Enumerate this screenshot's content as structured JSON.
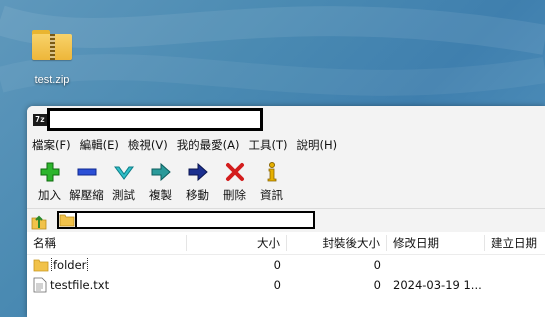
{
  "desktop": {
    "icon_label": "test.zip",
    "icon": "zip-folder-icon"
  },
  "window": {
    "app_icon_text": "7z",
    "title": ""
  },
  "menu": [
    "檔案(F)",
    "編輯(E)",
    "檢視(V)",
    "我的最愛(A)",
    "工具(T)",
    "說明(H)"
  ],
  "toolbar": [
    {
      "label": "加入",
      "icon": "add-icon"
    },
    {
      "label": "解壓縮",
      "icon": "extract-icon"
    },
    {
      "label": "測試",
      "icon": "test-icon"
    },
    {
      "label": "複製",
      "icon": "copy-icon"
    },
    {
      "label": "移動",
      "icon": "move-icon"
    },
    {
      "label": "刪除",
      "icon": "delete-icon"
    },
    {
      "label": "資訊",
      "icon": "info-icon"
    }
  ],
  "address": {
    "path": ""
  },
  "columns": {
    "name": "名稱",
    "size": "大小",
    "packed": "封裝後大小",
    "modified": "修改日期",
    "created": "建立日期"
  },
  "files": [
    {
      "name": "folder",
      "size": "0",
      "packed": "0",
      "modified": "",
      "created": "",
      "icon": "folder-icon"
    },
    {
      "name": "testfile.txt",
      "size": "0",
      "packed": "0",
      "modified": "2024-03-19 1...",
      "created": "",
      "icon": "text-file-icon"
    }
  ],
  "colors": {
    "desktop": "#4a8ab2",
    "window_bg": "#f3f3f3",
    "folder": "#f1c24a"
  }
}
